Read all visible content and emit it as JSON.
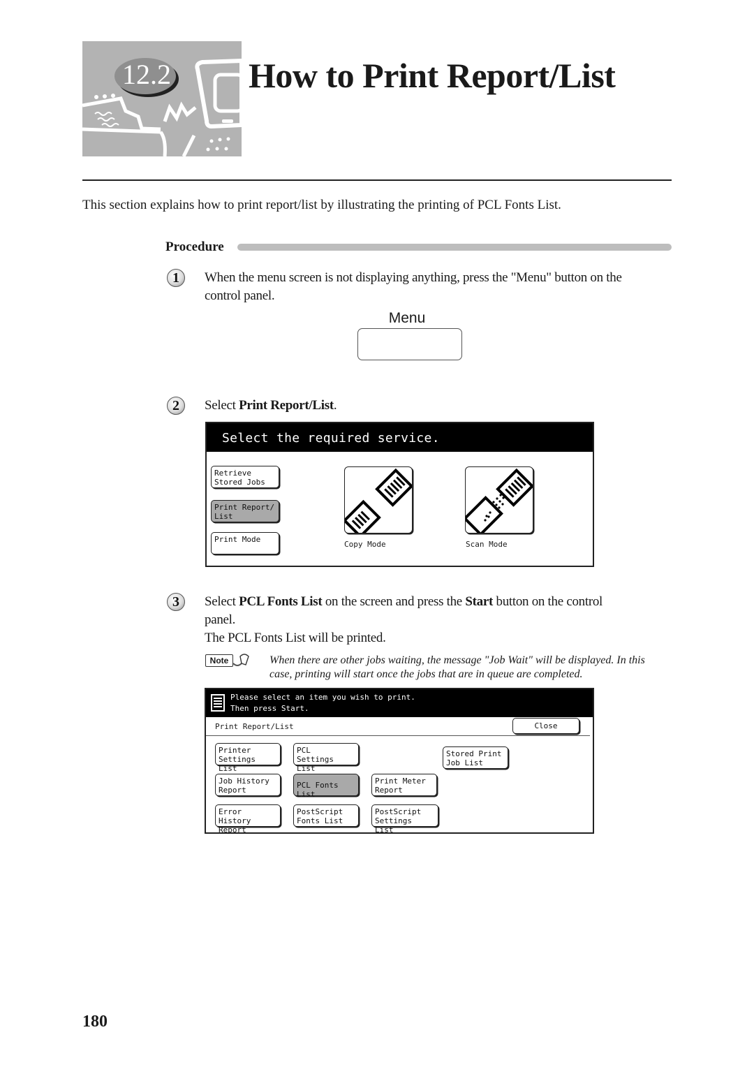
{
  "header": {
    "chapter_number": "12.2",
    "title": "How to Print Report/List"
  },
  "intro": "This section explains how to print report/list by illustrating the printing of PCL Fonts List.",
  "procedure_label": "Procedure",
  "steps": [
    {
      "number": "1",
      "text": "When the menu screen is not displaying anything, press the \"Menu\" button on the",
      "text_line2": "control panel.",
      "control_button_label": "Menu"
    },
    {
      "number": "2",
      "text_prefix": "Select ",
      "text_bold": "Print Report/List",
      "text_suffix": "."
    },
    {
      "number": "3",
      "seg1": "Select ",
      "bold1": "PCL Fonts List",
      "seg2": " on the screen and press the ",
      "bold2": "Start",
      "seg3": " button on the control",
      "line2": "panel.",
      "line3": "The PCL Fonts List will be printed."
    }
  ],
  "screen1": {
    "message": "Select the required service.",
    "buttons": [
      {
        "label": "Retrieve\nStored Jobs",
        "selected": false
      },
      {
        "label": "Print Report/\nList",
        "selected": true
      },
      {
        "label": "Print Mode",
        "selected": false
      }
    ],
    "modes": [
      {
        "label": "Copy Mode",
        "icon": "copy-mode-icon"
      },
      {
        "label": "Scan Mode",
        "icon": "scan-mode-icon"
      }
    ]
  },
  "note": {
    "badge": "Note",
    "text": "When there are other jobs waiting, the message \"Job Wait\" will be displayed. In this case, printing will start once the jobs that are in queue are completed."
  },
  "screen2": {
    "message_line1": "Please select an item you wish to print.",
    "message_line2": "Then press Start.",
    "title": "Print Report/List",
    "close_label": "Close",
    "buttons": [
      {
        "label": "Printer\nSettings List",
        "selected": false
      },
      {
        "label": "PCL\nSettings List",
        "selected": false
      },
      {
        "label": "Stored Print\nJob List",
        "selected": false
      },
      {
        "label": "Job History\nReport",
        "selected": false
      },
      {
        "label": "PCL Fonts List",
        "selected": true
      },
      {
        "label": "Print Meter\nReport",
        "selected": false
      },
      {
        "label": "Error History\nReport",
        "selected": false
      },
      {
        "label": "PostScript\nFonts List",
        "selected": false
      },
      {
        "label": "PostScript\nSettings List",
        "selected": false
      }
    ]
  },
  "page_number": "180"
}
